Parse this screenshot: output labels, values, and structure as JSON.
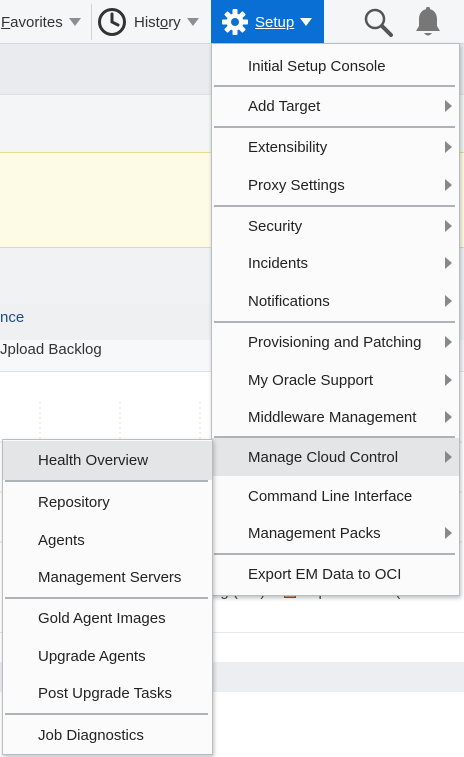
{
  "topbar": {
    "favorites_label": "Favorites",
    "favorites_hotkey": "F",
    "favorites_rest": "avorites",
    "history_pre": "Hist",
    "history_hotkey": "o",
    "history_post": "ry",
    "setup_hotkey": "S",
    "setup_rest": "etup",
    "icons": [
      "clock-icon",
      "gear-icon",
      "search-icon",
      "bell-icon"
    ],
    "colors": {
      "setup_bg": "#0a6fd4",
      "bar_bg": "#f5f6f7"
    }
  },
  "background": {
    "link_text": "nce",
    "label_text": "Jpload Backlog",
    "legend_text_a": "og (MB)",
    "legend_text_b": "Upload Rate (MB/s"
  },
  "setup_menu": {
    "items": [
      {
        "label": "Initial Setup Console",
        "submenu": false
      },
      {
        "label": "Add Target",
        "submenu": true
      },
      {
        "label": "Extensibility",
        "submenu": true
      },
      {
        "label": "Proxy Settings",
        "submenu": true
      },
      {
        "label": "Security",
        "submenu": true
      },
      {
        "label": "Incidents",
        "submenu": true
      },
      {
        "label": "Notifications",
        "submenu": true
      },
      {
        "label": "Provisioning and Patching",
        "submenu": true
      },
      {
        "label": "My Oracle Support",
        "submenu": true
      },
      {
        "label": "Middleware Management",
        "submenu": true
      },
      {
        "label": "Manage Cloud Control",
        "submenu": true,
        "active": true
      },
      {
        "label": "Command Line Interface",
        "submenu": false
      },
      {
        "label": "Management Packs",
        "submenu": true
      },
      {
        "label": "Export EM Data to OCI",
        "submenu": false
      }
    ]
  },
  "cloud_menu": {
    "items": [
      {
        "label": "Health Overview",
        "active": true
      },
      {
        "label": "Repository"
      },
      {
        "label": "Agents"
      },
      {
        "label": "Management Servers"
      },
      {
        "label": "Gold Agent Images"
      },
      {
        "label": "Upgrade Agents"
      },
      {
        "label": "Post Upgrade Tasks"
      },
      {
        "label": "Job Diagnostics"
      }
    ]
  }
}
